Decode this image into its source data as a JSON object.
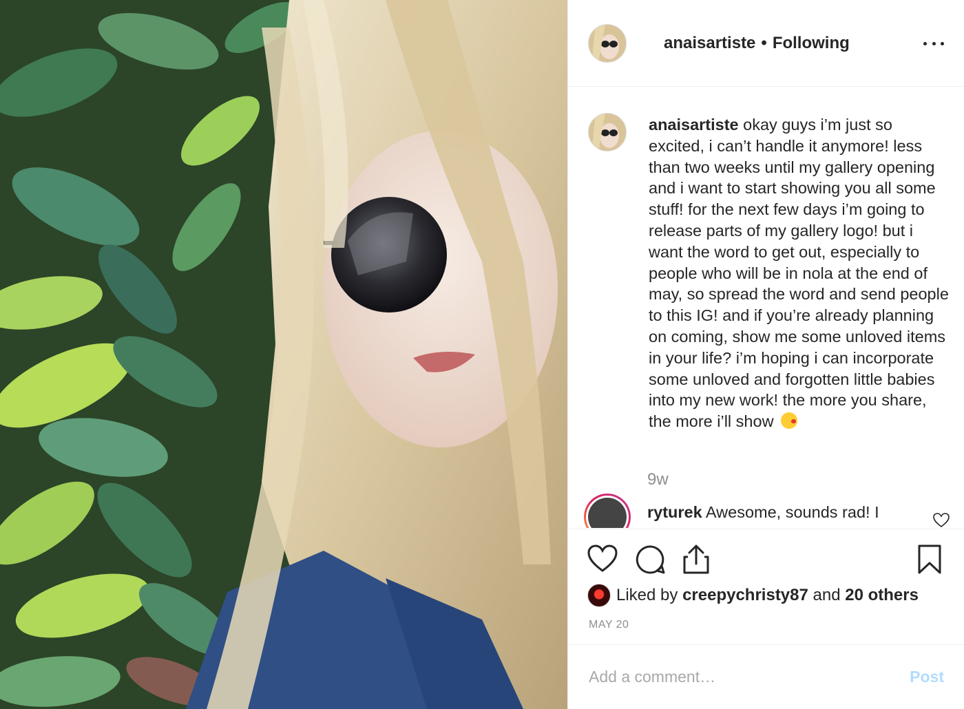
{
  "post": {
    "author": "anaisartiste",
    "separator": "•",
    "follow_status": "Following",
    "caption": "okay guys i’m just so excited, i can’t handle it anymore! less than two weeks until my gallery opening and i want to start showing you all some stuff! for the next few days i’m going to release parts of my gallery logo! but i want the word to get out, especially to people who will be in nola at the end of may, so spread the word and send people to this IG! and if you’re already planning on coming, show me some unloved items in your life? i’m hoping i can incorporate some unloved and forgotten little babies into my new work! the more you share, the more i’ll show",
    "caption_time": "9w",
    "date": "MAY 20"
  },
  "reply": {
    "username": "ryturek",
    "text": "Awesome, sounds rad! I"
  },
  "likes": {
    "prefix": "Liked by",
    "liker": "creepychristy87",
    "joiner": "and",
    "others": "20 others"
  },
  "comment_box": {
    "placeholder": "Add a comment…",
    "post_label": "Post"
  },
  "icons": [
    "more-options-icon",
    "heart-icon",
    "comment-icon",
    "share-icon",
    "bookmark-icon",
    "kiss-emoji-icon"
  ],
  "colors": {
    "text": "#262626",
    "muted": "#8e8e8e",
    "post_disabled": "#b3dbff",
    "story_ring": "#e0245e"
  }
}
